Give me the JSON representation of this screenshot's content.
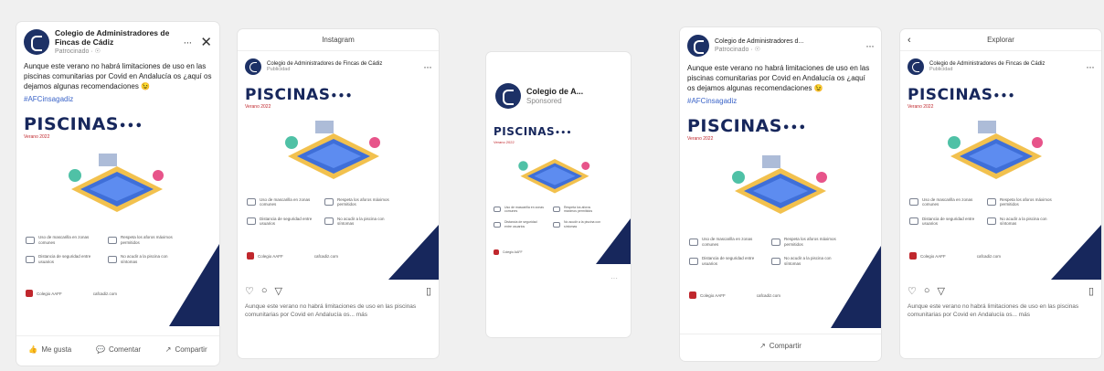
{
  "brand": {
    "navy": "#17275c",
    "red": "#c0272d",
    "link": "#3b64c8"
  },
  "fb": {
    "page_name": "Colegio de Administradores de Fincas de Cádiz",
    "page_name_short": "Colegio de Administradores d...",
    "sponsored": "Patrocinado · ☉",
    "post_text": "Aunque este verano no habrá limitaciones de uso en las piscinas comunitarias por Covid en Andalucía os ¿aquí os dejamos algunas recomendaciones 😉",
    "hashtag": "#AFCinsagadiz",
    "actions": {
      "like": "Me gusta",
      "comment": "Comentar",
      "share": "Compartir"
    }
  },
  "ig": {
    "feed_title": "Instagram",
    "explore_title": "Explorar",
    "account": "Colegio de Administradores de Fincas de Cádiz",
    "account_sub": "Publicidad",
    "caption": "Aunque este verano no habrá limitaciones de uso en las piscinas comunitarias por Covid en Andalucía os... más"
  },
  "story": {
    "account": "Colegio de A...",
    "sponsored": "Sponsored",
    "more": "···"
  },
  "creative": {
    "title": "PISCINAS",
    "dots": "•••",
    "subtitle": "Verano 2022",
    "items": [
      "Uso de mascarilla en zonas comunes",
      "Respeta los aforos máximos permitidos",
      "Distancia de seguridad entre usuarios",
      "No acudir a la piscina con síntomas"
    ],
    "footer_left": "Colegio AAFF",
    "footer_right": "cafcadiz.com"
  },
  "icons": {
    "close": "close-icon",
    "more": "more-options-icon",
    "like": "thumbs-up-icon",
    "comment": "comment-icon",
    "share": "share-icon",
    "heart": "heart-icon",
    "bookmark": "bookmark-icon",
    "back": "back-arrow-icon"
  }
}
